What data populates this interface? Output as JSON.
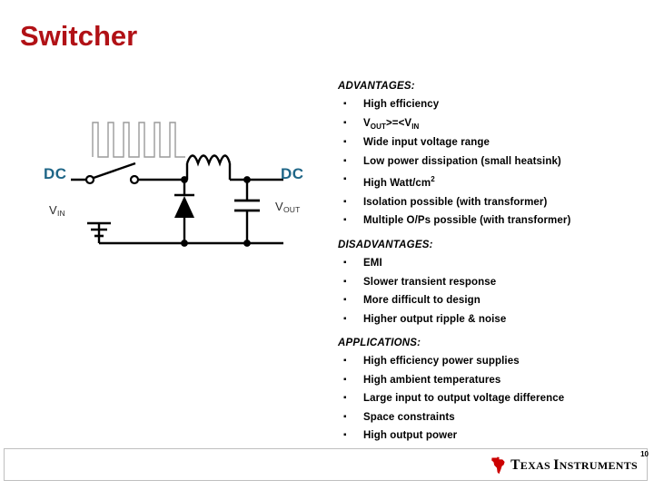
{
  "slide": {
    "title": "Switcher",
    "title_color": "#B11116",
    "page_number": "10"
  },
  "circuit": {
    "input_label": "DC",
    "output_label": "DC",
    "vin_main": "V",
    "vin_sub": "IN",
    "vout_main": "V",
    "vout_sub": "OUT",
    "label_color": "#1F6687",
    "wire_color": "#000000",
    "pulse_color": "#9a9a9a",
    "pulse_count": 6,
    "inductor_loops": 4,
    "components": [
      "switch",
      "pulse-train",
      "diode",
      "inductor",
      "capacitor",
      "ground"
    ]
  },
  "sections": [
    {
      "heading": "ADVANTAGES:",
      "items": [
        {
          "text": "High efficiency"
        },
        {
          "text": "VOUT>=<VIN",
          "rich": true,
          "parts": [
            {
              "t": "V"
            },
            {
              "t": "OUT",
              "style": "sub"
            },
            {
              "t": ">=<"
            },
            {
              "t": "V"
            },
            {
              "t": "IN",
              "style": "sub"
            }
          ]
        },
        {
          "text": "Wide input voltage range"
        },
        {
          "text": "Low power dissipation (small heatsink)"
        },
        {
          "text": "High Watt/cm2",
          "rich": true,
          "parts": [
            {
              "t": "High Watt/cm"
            },
            {
              "t": "2",
              "style": "sup"
            }
          ]
        },
        {
          "text": "Isolation possible (with transformer)"
        },
        {
          "text": "Multiple O/Ps possible (with transformer)"
        }
      ]
    },
    {
      "heading": "DISADVANTAGES:",
      "items": [
        {
          "text": "EMI"
        },
        {
          "text": "Slower transient response"
        },
        {
          "text": "More difficult to design"
        },
        {
          "text": "Higher output ripple & noise"
        }
      ]
    },
    {
      "heading": "APPLICATIONS:",
      "items": [
        {
          "text": "High efficiency power supplies"
        },
        {
          "text": "High ambient temperatures"
        },
        {
          "text": "Large input to output voltage difference"
        },
        {
          "text": "Space constraints"
        },
        {
          "text": "High output power"
        }
      ]
    }
  ],
  "bullet_glyph": "▪",
  "footer": {
    "logo_text_first": "T",
    "logo_text_rest": "EXAS ",
    "logo_text_second": "I",
    "logo_text_rest2": "NSTRUMENTS",
    "logo_color": "#CC0000"
  }
}
